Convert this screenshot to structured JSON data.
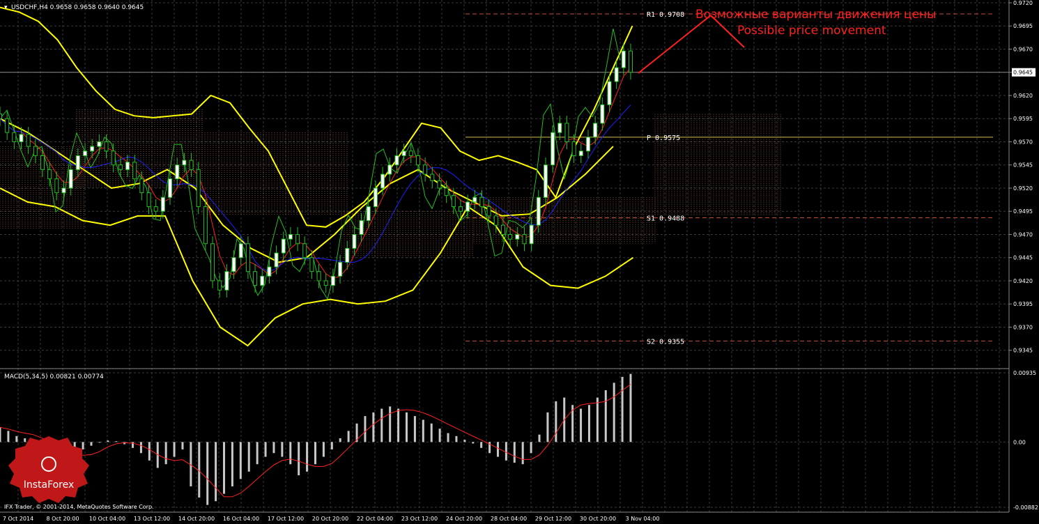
{
  "header": {
    "symbol_info": "USDCHF,H4  0.9658 0.9658 0.9640 0.9645",
    "macd_info": "MACD(5,34,5) 0.00821 0.00774",
    "copyright": "IFX Trader, © 2001-2014, MetaQuotes Software Corp."
  },
  "annotation": {
    "ru": "Возможные варианты движения цены",
    "en": "Possible price movement"
  },
  "logo": {
    "text": "InstaForex"
  },
  "colors": {
    "background": "#000000",
    "grid": "#3a3a3a",
    "bollinger": "#ffff00",
    "candle": "#ffffff",
    "green_line": "#22c022",
    "red_line": "#ff2020",
    "blue_line": "#2020ff",
    "cloud": "#c87850",
    "pivot_R": "#c0503c",
    "pivot_P": "#d8c050",
    "annotation": "#ff2020",
    "macd_hist": "#c8c8c8"
  },
  "chart_data": [
    {
      "type": "line",
      "title": "USDCHF,H4",
      "symbol": "USDCHF",
      "timeframe": "H4",
      "ohlc_last": {
        "open": 0.9658,
        "high": 0.9658,
        "low": 0.964,
        "close": 0.9645
      },
      "current_price": 0.9645,
      "current_price_label": "0.9645",
      "ylim": [
        0.9332,
        0.972
      ],
      "y_ticks": [
        "0.9720",
        "0.9695",
        "0.9670",
        "0.9645",
        "0.9620",
        "0.9595",
        "0.9570",
        "0.9545",
        "0.9520",
        "0.9495",
        "0.9470",
        "0.9445",
        "0.9420",
        "0.9395",
        "0.9370",
        "0.9345"
      ],
      "x_ticks": [
        "7 Oct 2014",
        "8 Oct 20:00",
        "10 Oct 04:00",
        "13 Oct 12:00",
        "14 Oct 20:00",
        "16 Oct 04:00",
        "17 Oct 12:00",
        "20 Oct 20:00",
        "22 Oct 04:00",
        "23 Oct 12:00",
        "24 Oct 20:00",
        "28 Oct 04:00",
        "29 Oct 12:00",
        "30 Oct 20:00",
        "3 Nov 04:00"
      ],
      "pivot_levels": [
        {
          "name": "R1",
          "value": 0.9708,
          "label": "R1  0.9708"
        },
        {
          "name": "P",
          "value": 0.9575,
          "label": "P  0.9575"
        },
        {
          "name": "S1",
          "value": 0.9488,
          "label": "S1  0.9488"
        },
        {
          "name": "S2",
          "value": 0.9355,
          "label": "S2  0.9355"
        }
      ],
      "close_series": [
        0.9595,
        0.958,
        0.957,
        0.9578,
        0.9565,
        0.9555,
        0.954,
        0.953,
        0.9515,
        0.952,
        0.954,
        0.9555,
        0.956,
        0.9565,
        0.957,
        0.956,
        0.9545,
        0.954,
        0.9548,
        0.953,
        0.9515,
        0.95,
        0.9495,
        0.951,
        0.953,
        0.9545,
        0.955,
        0.954,
        0.95,
        0.946,
        0.942,
        0.941,
        0.943,
        0.9445,
        0.946,
        0.943,
        0.9415,
        0.9425,
        0.9435,
        0.945,
        0.9465,
        0.947,
        0.946,
        0.9445,
        0.943,
        0.942,
        0.9415,
        0.9425,
        0.944,
        0.9455,
        0.947,
        0.9485,
        0.95,
        0.952,
        0.9535,
        0.9545,
        0.9555,
        0.956,
        0.9555,
        0.9545,
        0.9535,
        0.9528,
        0.952,
        0.9512,
        0.95,
        0.9495,
        0.9505,
        0.951,
        0.95,
        0.949,
        0.948,
        0.947,
        0.9465,
        0.947,
        0.946,
        0.948,
        0.951,
        0.9545,
        0.958,
        0.959,
        0.957,
        0.9555,
        0.956,
        0.9575,
        0.959,
        0.961,
        0.9635,
        0.965,
        0.9668,
        0.9645
      ],
      "bollinger_upper": [
        0.9715,
        0.971,
        0.97,
        0.968,
        0.965,
        0.9625,
        0.9605,
        0.9598,
        0.9596,
        0.9598,
        0.96,
        0.962,
        0.9612,
        0.9585,
        0.956,
        0.952,
        0.948,
        0.9478,
        0.949,
        0.9505,
        0.953,
        0.956,
        0.959,
        0.9585,
        0.956,
        0.955,
        0.9555,
        0.9548,
        0.954,
        0.951,
        0.9565,
        0.9605,
        0.965,
        0.9695
      ],
      "bollinger_middle": [
        0.9595,
        0.958,
        0.956,
        0.954,
        0.952,
        0.9525,
        0.954,
        0.952,
        0.948,
        0.9455,
        0.944,
        0.9445,
        0.947,
        0.95,
        0.9525,
        0.954,
        0.952,
        0.9505,
        0.949,
        0.9492,
        0.951,
        0.9535,
        0.9565
      ],
      "bollinger_lower": [
        0.952,
        0.9505,
        0.95,
        0.9485,
        0.948,
        0.949,
        0.949,
        0.942,
        0.937,
        0.935,
        0.938,
        0.9395,
        0.94,
        0.9395,
        0.9398,
        0.941,
        0.945,
        0.95,
        0.948,
        0.9435,
        0.9415,
        0.9412,
        0.9425,
        0.9445
      ]
    },
    {
      "type": "bar",
      "title": "MACD(5,34,5)",
      "macd_value": 0.00821,
      "signal_value": 0.00774,
      "ylim": [
        -0.00882,
        0.00935
      ],
      "y_ticks": [
        "0.00935",
        "0.00",
        "-0.00882"
      ],
      "histogram": [
        0.002,
        0.0015,
        0.0008,
        0.0005,
        0.0002,
        -0.0002,
        -0.001,
        -0.002,
        -0.003,
        -0.002,
        -0.001,
        -0.0005,
        0.0,
        0.0002,
        0.0001,
        -0.0003,
        -0.0008,
        -0.0015,
        -0.0025,
        -0.0035,
        -0.003,
        -0.002,
        -0.001,
        -0.006,
        -0.0075,
        -0.0085,
        -0.008,
        -0.007,
        -0.006,
        -0.005,
        -0.004,
        -0.003,
        -0.002,
        -0.0015,
        -0.002,
        -0.003,
        -0.0045,
        -0.004,
        -0.003,
        -0.002,
        -0.001,
        0.0005,
        0.0015,
        0.0025,
        0.0035,
        0.004,
        0.0045,
        0.0048,
        0.0045,
        0.004,
        0.0035,
        0.003,
        0.0025,
        0.0018,
        0.0012,
        0.0008,
        0.0003,
        -0.0002,
        -0.0008,
        -0.0015,
        -0.002,
        -0.0025,
        -0.0028,
        -0.003,
        -0.0015,
        0.001,
        0.004,
        0.0055,
        0.006,
        0.005,
        0.0045,
        0.005,
        0.006,
        0.007,
        0.008,
        0.0088,
        0.0092
      ]
    }
  ]
}
